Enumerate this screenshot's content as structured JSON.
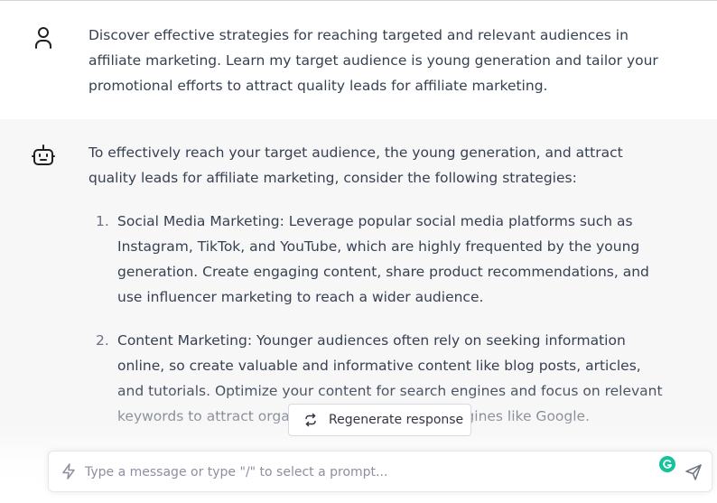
{
  "conversation": {
    "user_message": "Discover effective strategies for reaching targeted and relevant audiences in affiliate marketing. Learn my target audience is young generation and tailor your promotional efforts to attract quality leads for affiliate marketing.",
    "assistant_intro": "To effectively reach your target audience, the young generation, and attract quality leads for affiliate marketing, consider the following strategies:",
    "assistant_list": [
      {
        "number": "1.",
        "text": "Social Media Marketing: Leverage popular social media platforms such as Instagram, TikTok, and YouTube, which are highly frequented by the young generation. Create engaging content, share product recommendations, and use influencer marketing to reach a wider audience."
      },
      {
        "number": "2.",
        "text": "Content Marketing: Younger audiences often rely on seeking information online, so create valuable and informative content like blog posts, articles, and tutorials. Optimize your content for search engines and focus on relevant keywords to attract organic traffic from search engines like Google."
      }
    ]
  },
  "regenerate": {
    "label": "Regenerate response"
  },
  "composer": {
    "placeholder": "Type a message or type \"/\" to select a prompt...",
    "value": ""
  },
  "icons": {
    "user": "user-icon",
    "assistant": "robot-icon",
    "regenerate": "regenerate-icon",
    "prompt": "bolt-icon",
    "grammarly": "grammarly-icon",
    "send": "send-icon"
  },
  "colors": {
    "assistant_background": "#f7f7f8",
    "text": "#374151",
    "grammarly": "#15c39a"
  }
}
